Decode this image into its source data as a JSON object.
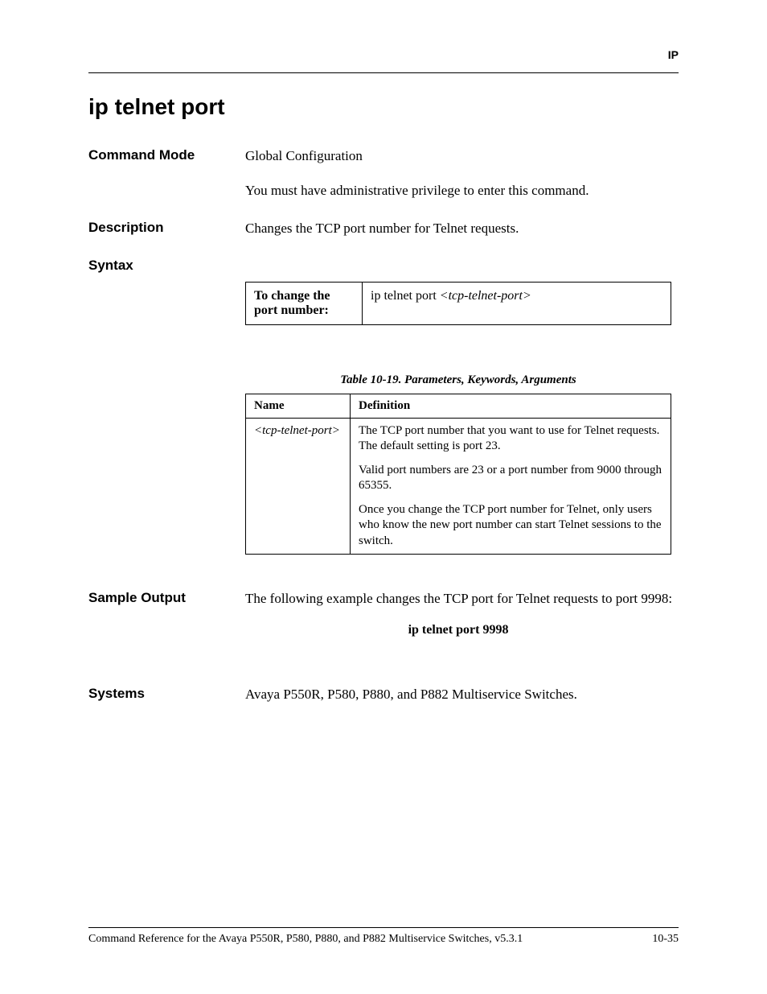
{
  "header": {
    "label": "IP"
  },
  "title": "ip telnet port",
  "command_mode": {
    "label": "Command Mode",
    "value": "Global Configuration",
    "note": "You must have administrative privilege to enter this command."
  },
  "description": {
    "label": "Description",
    "value": "Changes the TCP port number for Telnet requests."
  },
  "syntax": {
    "label": "Syntax",
    "row_label": "To change the port number:",
    "row_value_prefix": "ip telnet port ",
    "row_value_arg": "<tcp-telnet-port>"
  },
  "param_table": {
    "caption": "Table 10-19.  Parameters, Keywords, Arguments",
    "headers": {
      "name": "Name",
      "definition": "Definition"
    },
    "row": {
      "name": "<tcp-telnet-port>",
      "def1": "The TCP port number that you want to use for Telnet requests. The default setting is port 23.",
      "def2": "Valid port numbers are 23 or a port number from 9000 through 65355.",
      "def3": "Once you change the TCP port number for Telnet, only users who know the new port number can start Telnet sessions to the switch."
    }
  },
  "sample_output": {
    "label": "Sample Output",
    "text": "The following example changes the TCP port for Telnet requests to port 9998:",
    "command": "ip telnet port 9998"
  },
  "systems": {
    "label": "Systems",
    "value": "Avaya P550R, P580, P880, and P882 Multiservice Switches."
  },
  "footer": {
    "left": "Command Reference for the Avaya P550R, P580, P880, and P882 Multiservice Switches, v5.3.1",
    "right": "10-35"
  }
}
